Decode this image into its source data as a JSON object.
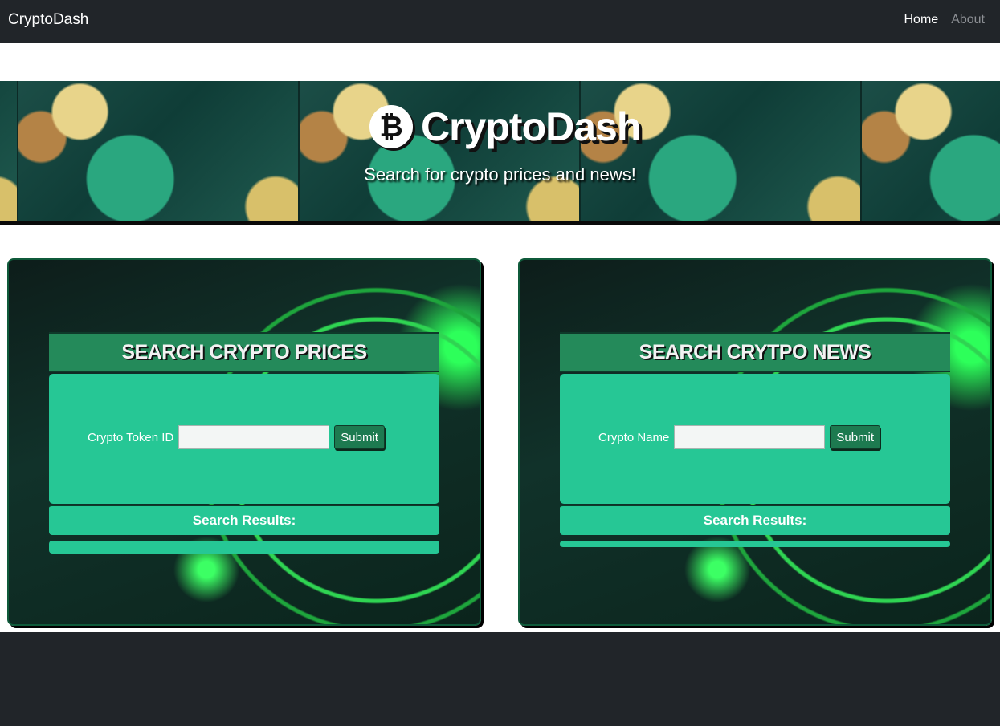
{
  "navbar": {
    "brand": "CryptoDash",
    "links": [
      {
        "label": "Home",
        "active": true
      },
      {
        "label": "About",
        "active": false
      }
    ]
  },
  "hero": {
    "logo_icon": "bitcoin-icon",
    "logo_glyph": "₿",
    "title": "CryptoDash",
    "subtitle": "Search for crypto prices and news!"
  },
  "panels": {
    "prices": {
      "title": "SEARCH CRYPTO PRICES",
      "field_label": "Crypto Token ID",
      "input_value": "",
      "submit_label": "Submit",
      "results_label": "Search Results:"
    },
    "news": {
      "title": "SEARCH CRYTPO NEWS",
      "field_label": "Crypto Name",
      "input_value": "",
      "submit_label": "Submit",
      "results_label": "Search Results:"
    }
  },
  "colors": {
    "navbar": "#212529",
    "card_green": "#26c795",
    "header_green": "#248a5a",
    "button_green": "#1d7a50"
  }
}
